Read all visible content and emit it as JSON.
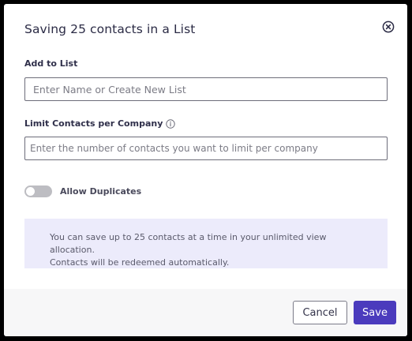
{
  "dialog": {
    "title": "Saving 25 contacts in a List"
  },
  "list_field": {
    "label": "Add to List",
    "placeholder": "Enter Name or Create New List",
    "value": ""
  },
  "limit_field": {
    "label": "Limit Contacts per Company",
    "placeholder": "Enter the number of contacts you want to limit per company",
    "value": ""
  },
  "duplicates_toggle": {
    "label": "Allow Duplicates",
    "enabled": false
  },
  "notice": {
    "line1": "You can save up to 25 contacts at a time in your unlimited view allocation.",
    "line2": "Contacts will be redeemed automatically."
  },
  "footer": {
    "cancel_label": "Cancel",
    "save_label": "Save"
  },
  "icons": {
    "close": "close-circle-icon",
    "info": "info-icon"
  },
  "colors": {
    "primary": "#4b3bbd",
    "notice_bg": "#ecebfb",
    "toggle_off": "#bdbdc2"
  }
}
